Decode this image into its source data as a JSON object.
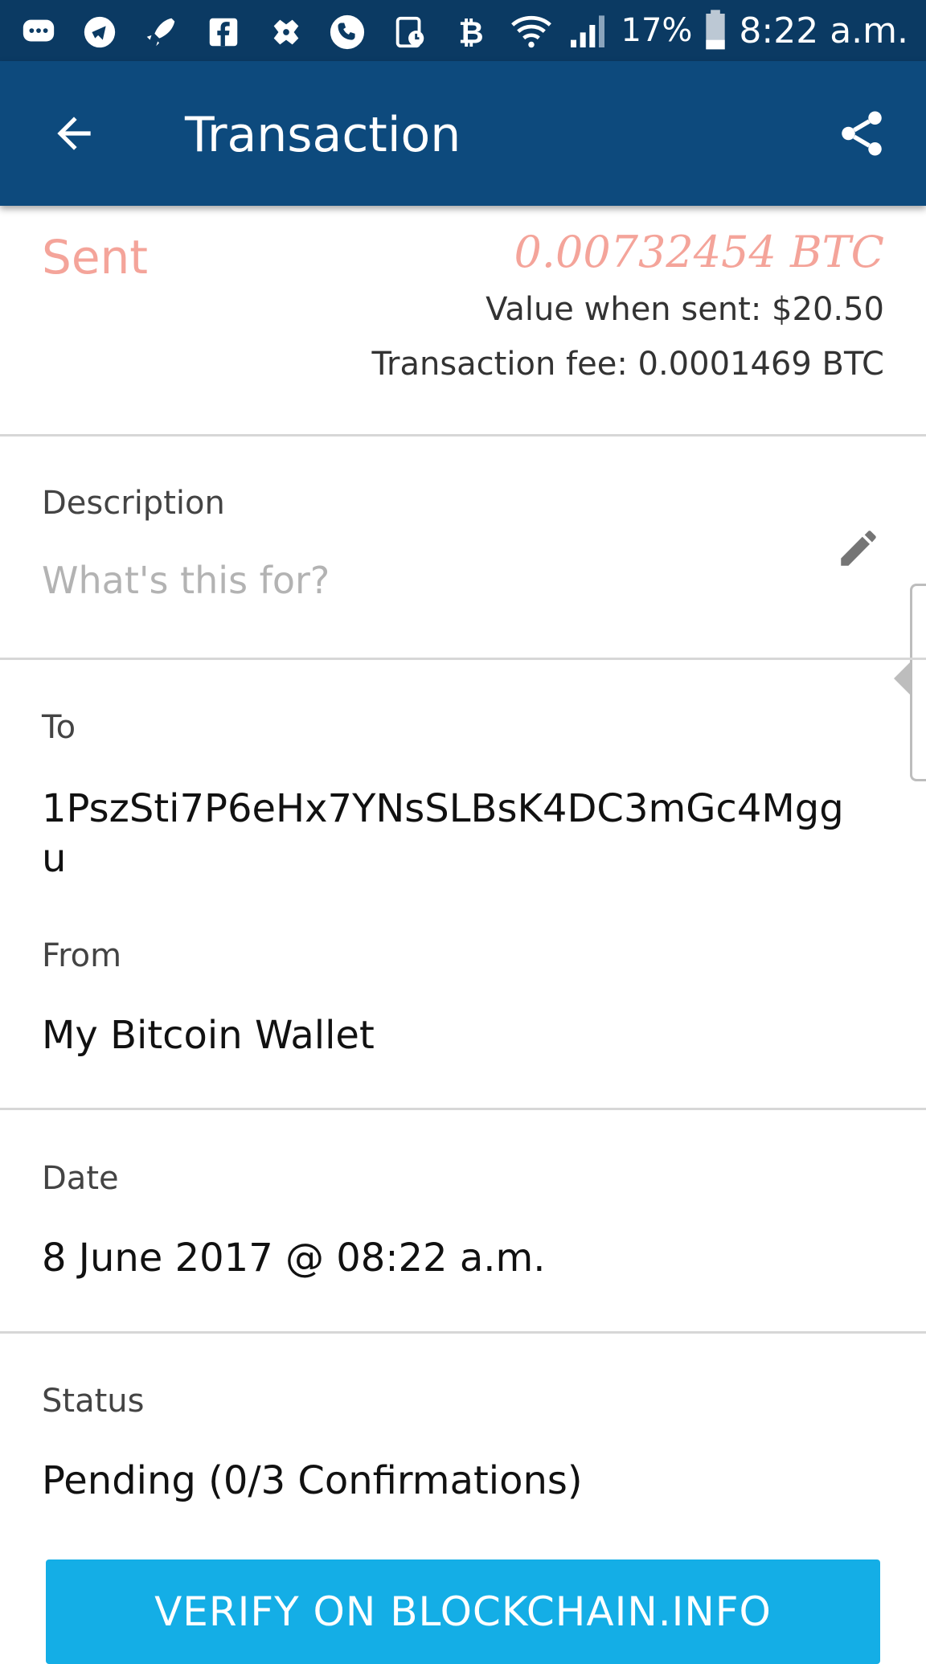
{
  "status_bar": {
    "battery": "17%",
    "time": "8:22 a.m.",
    "icons": [
      "chat-bubble-icon",
      "telegram-icon",
      "rocket-icon",
      "facebook-icon",
      "game-controller-icon",
      "phone-icon",
      "clock-alarm-icon",
      "bitcoin-icon",
      "wifi-icon",
      "signal-icon",
      "battery-icon"
    ]
  },
  "app_bar": {
    "title": "Transaction",
    "back_icon": "arrow-left-icon",
    "share_icon": "share-icon"
  },
  "summary": {
    "direction": "Sent",
    "amount": "0.00732454 BTC",
    "value_when_sent": "Value when sent: $20.50",
    "transaction_fee": "Transaction fee: 0.0001469 BTC",
    "accent_color": "#f4a49a"
  },
  "description": {
    "label": "Description",
    "placeholder": "What's this for?",
    "edit_icon": "pencil-icon"
  },
  "to": {
    "label": "To",
    "address_line1": "1PszSti7P6eHx7YNsSLBsK4DC3mGc4Mgg",
    "address_line2": "u"
  },
  "from": {
    "label": "From",
    "value": "My Bitcoin Wallet"
  },
  "date": {
    "label": "Date",
    "value": "8 June 2017 @ 08:22 a.m."
  },
  "status": {
    "label": "Status",
    "value": "Pending (0/3 Confirmations)"
  },
  "verify_button": {
    "label": "VERIFY ON BLOCKCHAIN.INFO",
    "color": "#14aee6"
  }
}
